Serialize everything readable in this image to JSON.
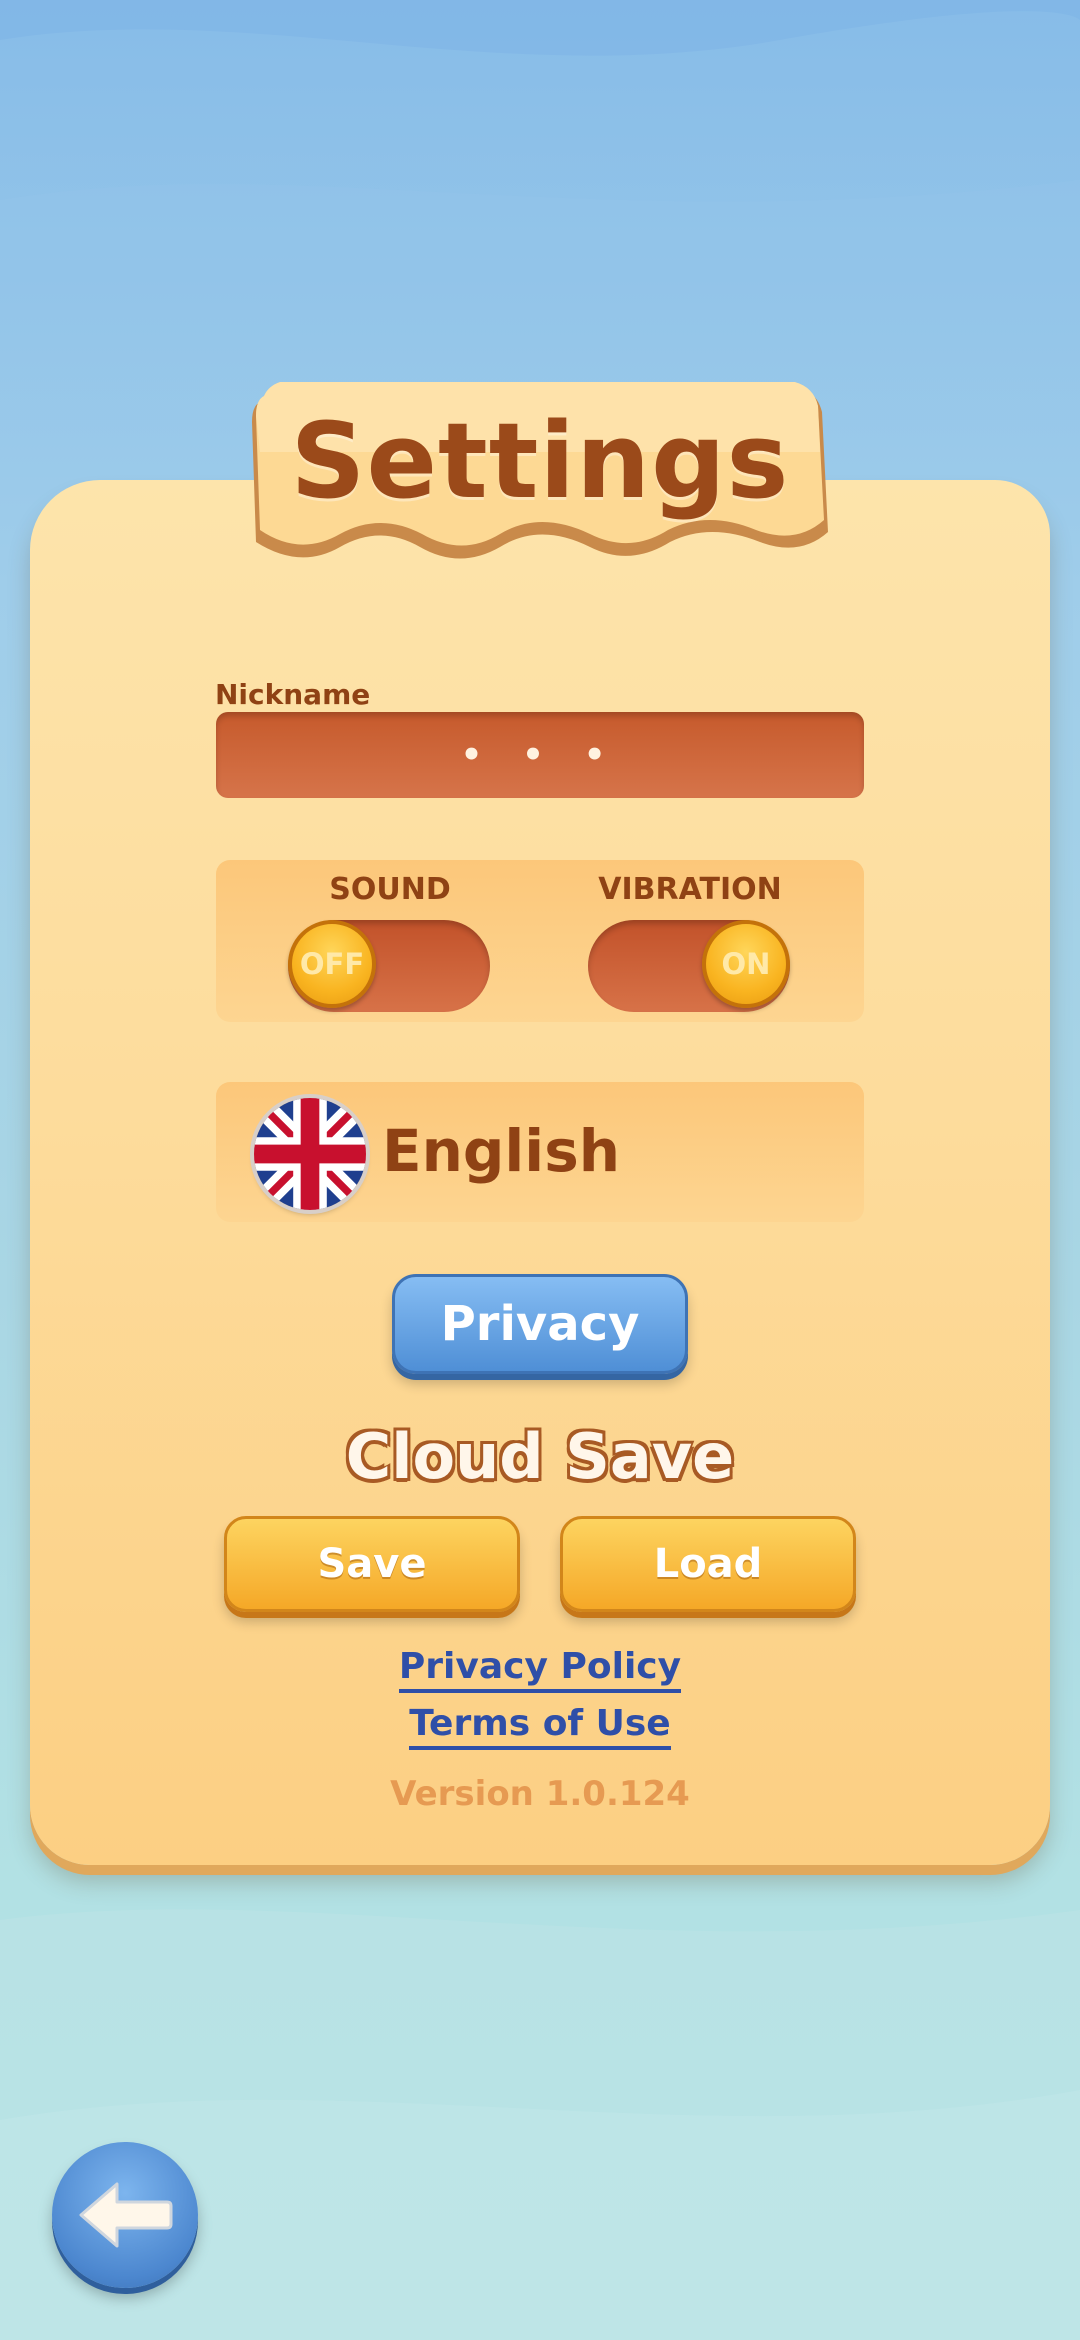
{
  "settings": {
    "title": "Settings",
    "nickname_label": "Nickname",
    "nickname_value": "• • •",
    "sound": {
      "label": "SOUND",
      "state": "OFF"
    },
    "vibration": {
      "label": "VIBRATION",
      "state": "ON"
    },
    "language": {
      "name": "English",
      "flag_icon": "uk-flag-icon"
    },
    "privacy_button": "Privacy",
    "cloud_save": {
      "title": "Cloud Save",
      "save_label": "Save",
      "load_label": "Load"
    },
    "links": {
      "privacy_policy": "Privacy Policy",
      "terms_of_use": "Terms of Use"
    },
    "version": "Version 1.0.124"
  },
  "navigation": {
    "back_icon": "arrow-left-icon"
  },
  "colors": {
    "panel": "#fddc9c",
    "title_text": "#9b4a1a",
    "toggle_track": "#c65a2c",
    "knob": "#f9b420",
    "privacy_button": "#4f8fd6",
    "orange_button": "#f5a827",
    "link": "#2f4fa8",
    "version": "#e69a52"
  }
}
